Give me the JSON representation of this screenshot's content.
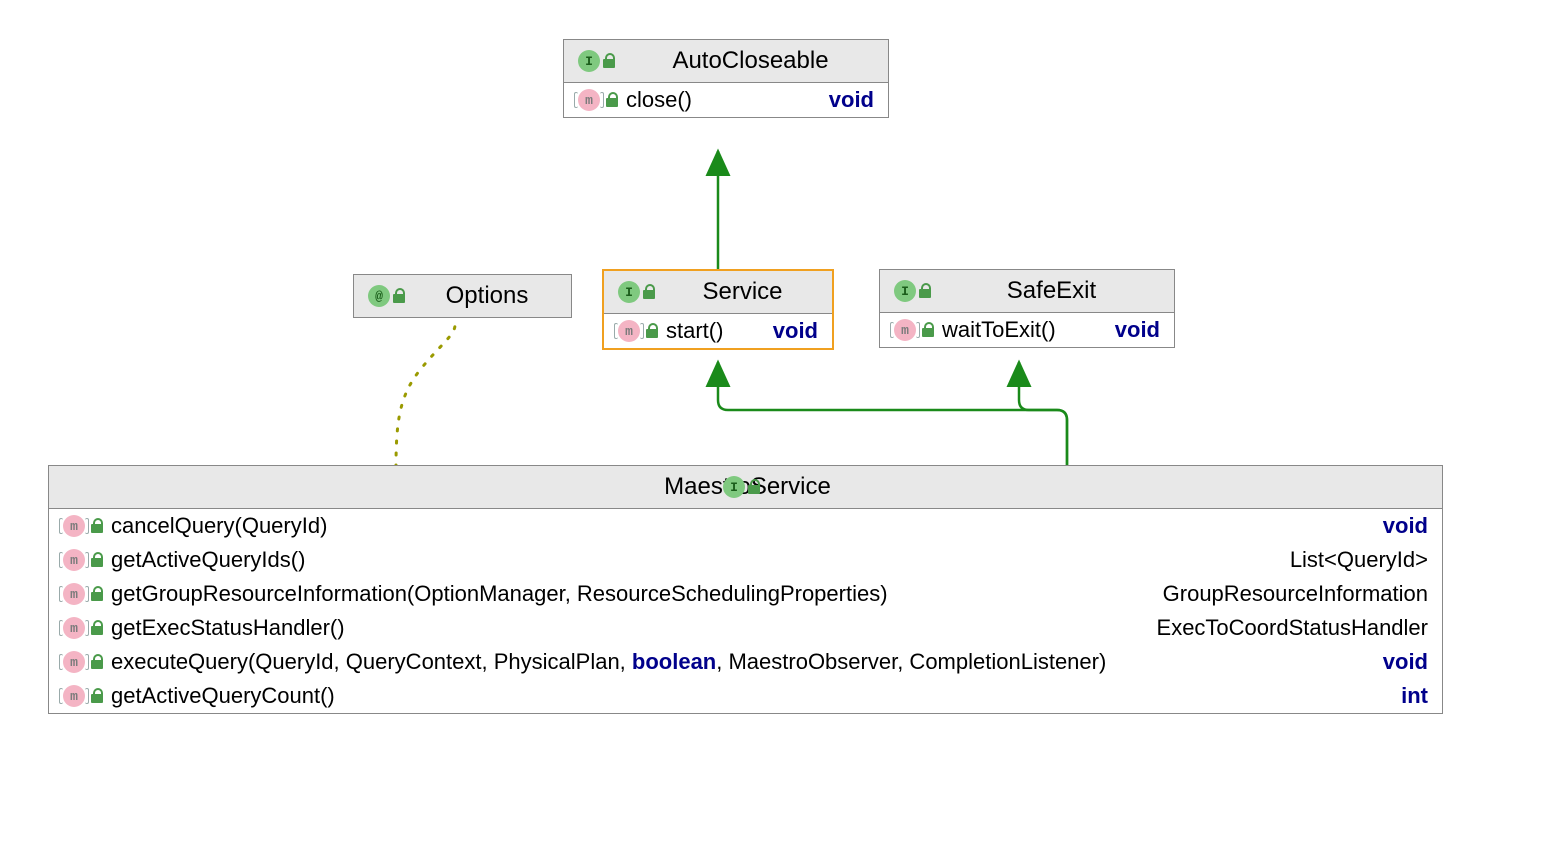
{
  "diagram": {
    "type": "uml-class-diagram",
    "nodes": {
      "autoCloseable": {
        "kind": "interface",
        "name": "AutoCloseable",
        "methods": [
          {
            "signature": "close()",
            "returns": "void",
            "returnsKeyword": true
          }
        ]
      },
      "options": {
        "kind": "annotation",
        "name": "Options",
        "methods": []
      },
      "service": {
        "kind": "interface",
        "name": "Service",
        "selected": true,
        "methods": [
          {
            "signature": "start()",
            "returns": "void",
            "returnsKeyword": true
          }
        ]
      },
      "safeExit": {
        "kind": "interface",
        "name": "SafeExit",
        "methods": [
          {
            "signature": "waitToExit()",
            "returns": "void",
            "returnsKeyword": true
          }
        ]
      },
      "maestroService": {
        "kind": "interface",
        "name": "MaestroService",
        "methods": [
          {
            "signature": "cancelQuery(QueryId)",
            "returns": "void",
            "returnsKeyword": true
          },
          {
            "signature": "getActiveQueryIds()",
            "returns": "List<QueryId>",
            "returnsKeyword": false
          },
          {
            "signature": "getGroupResourceInformation(OptionManager, ResourceSchedulingProperties)",
            "returns": "GroupResourceInformation",
            "returnsKeyword": false
          },
          {
            "signature": "getExecStatusHandler()",
            "returns": "ExecToCoordStatusHandler",
            "returnsKeyword": false
          },
          {
            "sigParts": [
              {
                "t": "executeQuery(QueryId, QueryContext, PhysicalPlan, ",
                "kw": false
              },
              {
                "t": "boolean",
                "kw": true
              },
              {
                "t": ", MaestroObserver, CompletionListener)",
                "kw": false
              }
            ],
            "returns": "void",
            "returnsKeyword": true
          },
          {
            "signature": "getActiveQueryCount()",
            "returns": "int",
            "returnsKeyword": true
          }
        ]
      }
    },
    "edges": [
      {
        "from": "service",
        "to": "autoCloseable",
        "style": "generalization"
      },
      {
        "from": "maestroService",
        "to": "service",
        "style": "generalization"
      },
      {
        "from": "maestroService",
        "to": "safeExit",
        "style": "generalization"
      },
      {
        "from": "maestroService",
        "to": "options",
        "style": "dependency-dotted"
      }
    ]
  },
  "colors": {
    "edgeSolid": "#1a8a1a",
    "edgeDotted": "#9a9a00",
    "selection": "#f0a020"
  }
}
